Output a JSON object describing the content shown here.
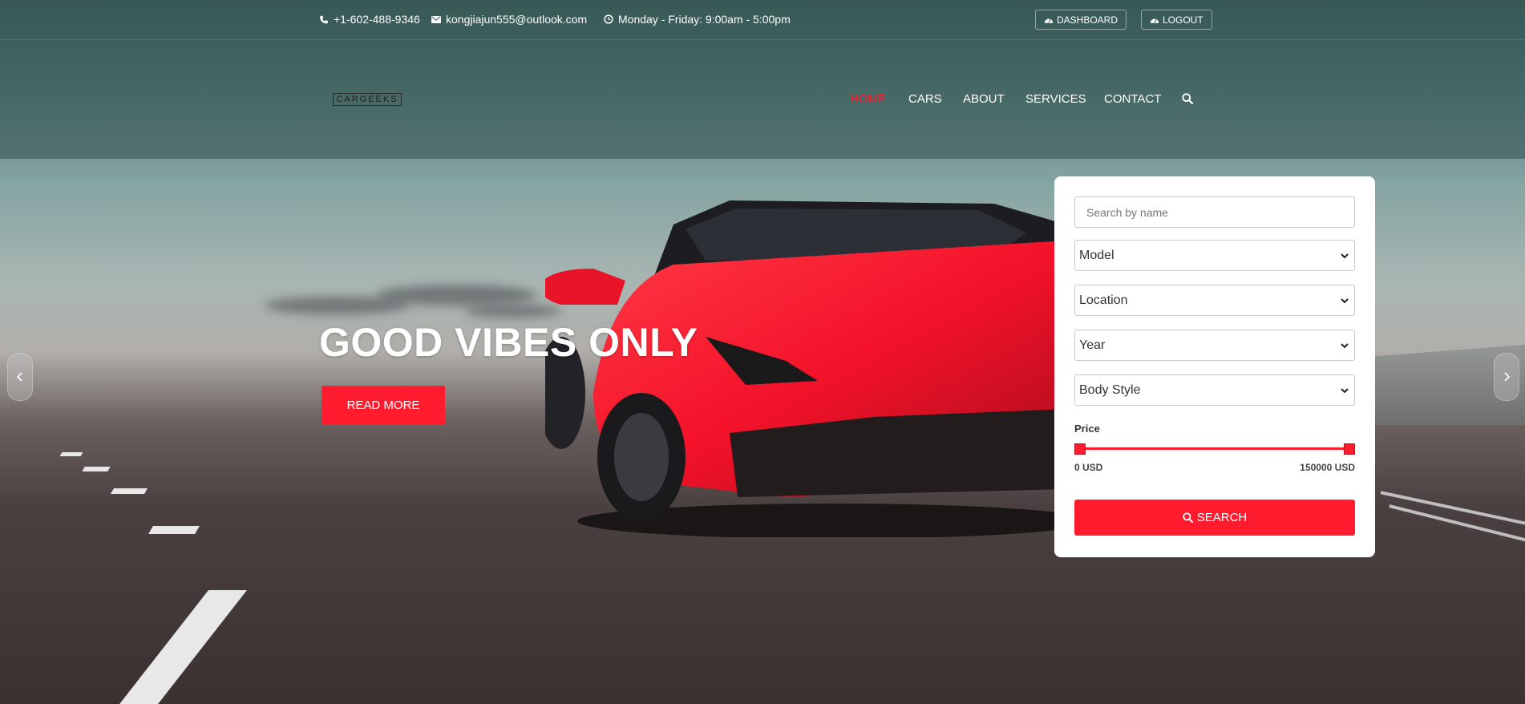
{
  "colors": {
    "accent": "#ff1c2f",
    "header_bg": "#3f6460",
    "panel_bg": "#ffffff"
  },
  "topbar": {
    "phone": {
      "icon": "phone-icon",
      "text": "+1-602-488-9346"
    },
    "email": {
      "icon": "envelope-icon",
      "text": "kongjiajun555@outlook.com"
    },
    "hours": {
      "icon": "clock-icon",
      "text": "Monday - Friday: 9:00am - 5:00pm"
    },
    "dashboard_button": {
      "icon": "dashboard-icon",
      "label": "DASHBOARD"
    },
    "logout_button": {
      "icon": "dashboard-icon",
      "label": "LOGOUT"
    }
  },
  "brand": {
    "logo_text": "CARGEEKS"
  },
  "nav": {
    "items": [
      {
        "label": "HOME",
        "active": true
      },
      {
        "label": "CARS",
        "active": false
      },
      {
        "label": "ABOUT",
        "active": false
      },
      {
        "label": "SERVICES",
        "active": false
      },
      {
        "label": "CONTACT",
        "active": false
      }
    ],
    "search_icon": "search-icon"
  },
  "hero": {
    "headline": "GOOD VIBES ONLY",
    "cta_label": "READ MORE",
    "prev_icon": "chevron-left-icon",
    "next_icon": "chevron-right-icon"
  },
  "search_panel": {
    "name_placeholder": "Search by name",
    "selects": [
      {
        "selected": "Model"
      },
      {
        "selected": "Location"
      },
      {
        "selected": "Year"
      },
      {
        "selected": "Body Style"
      }
    ],
    "price": {
      "label": "Price",
      "min_label": "0 USD",
      "max_label": "150000 USD",
      "range_min": 0,
      "range_max": 150000,
      "value_low": 0,
      "value_high": 150000
    },
    "search_button": {
      "icon": "search-icon",
      "label": "SEARCH"
    }
  }
}
